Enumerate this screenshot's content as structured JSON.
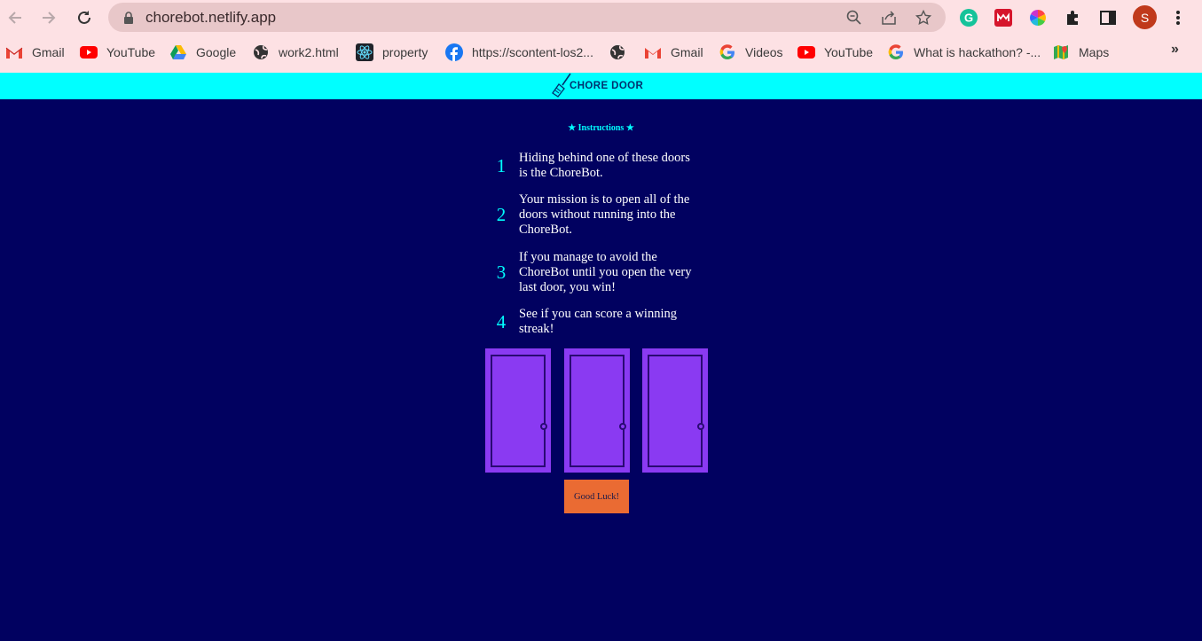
{
  "browser": {
    "url": "chorebot.netlify.app",
    "avatar_letter": "S",
    "bookmarks": [
      {
        "label": "Gmail",
        "icon": "gmail-icon"
      },
      {
        "label": "YouTube",
        "icon": "youtube-icon"
      },
      {
        "label": "Google",
        "icon": "google-drive-icon"
      },
      {
        "label": "work2.html",
        "icon": "globe-icon"
      },
      {
        "label": "property",
        "icon": "react-icon"
      },
      {
        "label": "https://scontent-los2...",
        "icon": "facebook-icon"
      },
      {
        "label": "",
        "icon": "globe-icon"
      },
      {
        "label": "Gmail",
        "icon": "gmail-icon"
      },
      {
        "label": "Videos",
        "icon": "google-icon"
      },
      {
        "label": "YouTube",
        "icon": "youtube-icon"
      },
      {
        "label": "What is hackathon? -...",
        "icon": "google-icon"
      },
      {
        "label": "Maps",
        "icon": "maps-icon"
      }
    ],
    "more_label": "»"
  },
  "page": {
    "title": "CHORE DOOR",
    "instructions_title": "★ Instructions ★",
    "rules": [
      {
        "num": "1",
        "text": "Hiding behind one of these doors is the ChoreBot."
      },
      {
        "num": "2",
        "text": "Your mission is to open all of the doors without running into the ChoreBot."
      },
      {
        "num": "3",
        "text": "If you manage to avoid the ChoreBot until you open the very last door, you win!"
      },
      {
        "num": "4",
        "text": "See if you can score a winning streak!"
      }
    ],
    "start_button": "Good Luck!"
  },
  "colors": {
    "background": "#010160",
    "header": "#00ffff",
    "door": "#8a3af2",
    "button": "#ea6b33"
  }
}
